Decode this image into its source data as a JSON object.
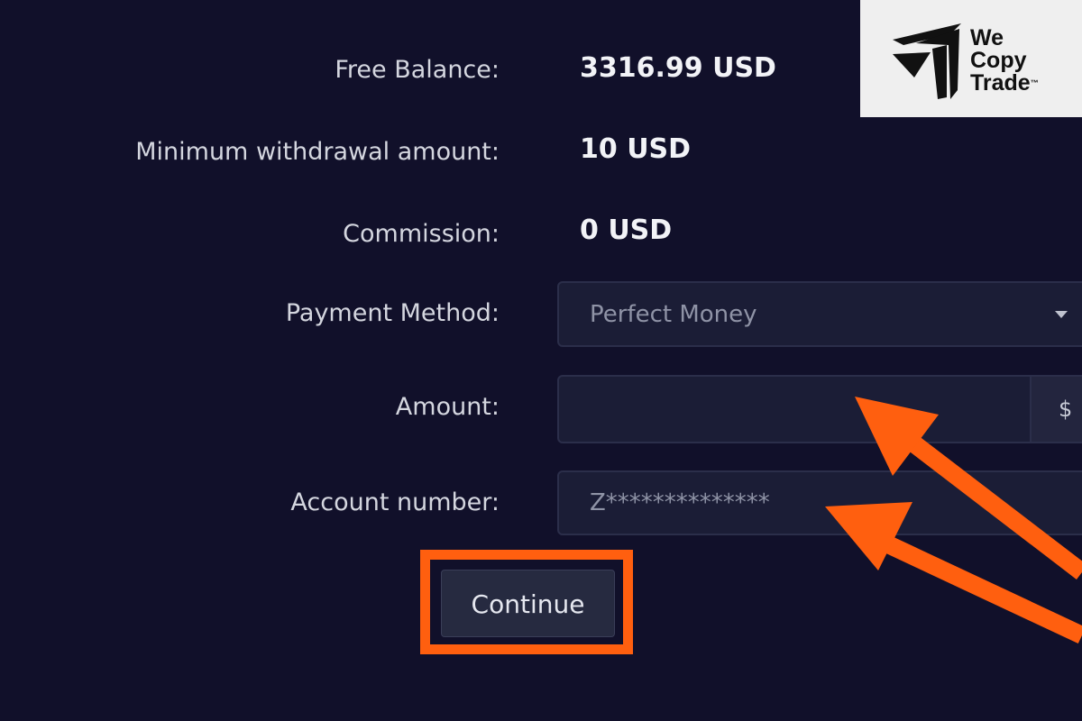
{
  "form": {
    "free_balance": {
      "label": "Free Balance:",
      "value": "3316.99 USD"
    },
    "min_withdrawal": {
      "label": "Minimum withdrawal amount:",
      "value": "10 USD"
    },
    "commission": {
      "label": "Commission:",
      "value": "0 USD"
    },
    "payment_method": {
      "label": "Payment Method:",
      "selected": "Perfect Money"
    },
    "amount": {
      "label": "Amount:",
      "value": "",
      "currency_symbol": "$"
    },
    "account_number": {
      "label": "Account number:",
      "value": "Z**************"
    },
    "continue_label": "Continue"
  },
  "logo": {
    "line1": "We",
    "line2": "Copy",
    "line3": "Trade",
    "tm": "™"
  },
  "colors": {
    "background": "#11102a",
    "highlight": "#ff5f0f",
    "field": "#1b1d36",
    "button": "#262a40"
  },
  "icons": [
    "dropdown-caret-icon",
    "wecopytrade-logo-icon",
    "arrow-annotation-icon"
  ]
}
